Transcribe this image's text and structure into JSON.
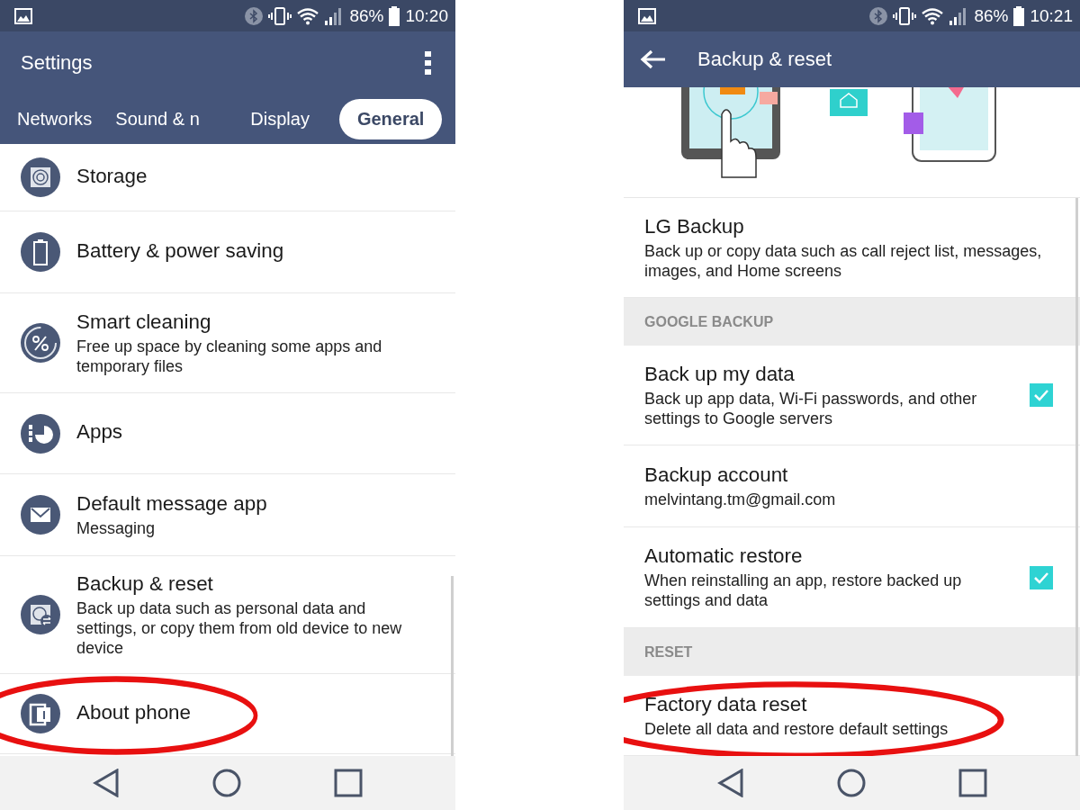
{
  "phones": [
    {
      "status": {
        "battery": "86%",
        "time": "10:20"
      },
      "app_bar": {
        "title": "Settings",
        "back": false,
        "menu": true
      },
      "tabs": [
        {
          "label": "Networks",
          "selected": false
        },
        {
          "label": "Sound & n",
          "selected": false
        },
        {
          "label": "Display",
          "selected": false
        },
        {
          "label": "General",
          "selected": true
        }
      ],
      "rows": [
        {
          "kind": "item",
          "title": "Storage",
          "circled": false
        },
        {
          "kind": "item",
          "title": "Battery & power saving",
          "circled": false
        },
        {
          "kind": "item",
          "title": "Smart cleaning",
          "subtitle": "Free up space by cleaning some apps and temporary files",
          "circled": false
        },
        {
          "kind": "item",
          "title": "Apps",
          "circled": false
        },
        {
          "kind": "item",
          "title": "Default message app",
          "subtitle": "Messaging",
          "circled": false
        },
        {
          "kind": "item",
          "title": "Backup & reset",
          "subtitle": "Back up data such as personal data and settings, or copy them from old device to new device",
          "circled": false
        },
        {
          "kind": "item",
          "title": "About phone",
          "circled": true
        }
      ]
    },
    {
      "status": {
        "battery": "86%",
        "time": "10:21"
      },
      "app_bar": {
        "title": "Backup & reset",
        "back": true,
        "menu": false
      },
      "rows": [
        {
          "kind": "illustration"
        },
        {
          "kind": "item",
          "title": "LG Backup",
          "subtitle": "Back up or copy data such as call reject list, messages, images, and Home screens",
          "circled": false
        },
        {
          "kind": "header",
          "title": "GOOGLE BACKUP"
        },
        {
          "kind": "item",
          "title": "Back up my data",
          "subtitle": "Back up app data, Wi-Fi passwords, and other settings to Google servers",
          "checked": true,
          "circled": false
        },
        {
          "kind": "item",
          "title": "Backup account",
          "subtitle": "melvintang.tm@gmail.com",
          "circled": false
        },
        {
          "kind": "item",
          "title": "Automatic restore",
          "subtitle": "When reinstalling an app, restore backed up settings and data",
          "checked": true,
          "circled": false
        },
        {
          "kind": "header",
          "title": "RESET"
        },
        {
          "kind": "item",
          "title": "Factory data reset",
          "subtitle": "Delete all data and restore default settings",
          "circled": true
        }
      ]
    }
  ]
}
